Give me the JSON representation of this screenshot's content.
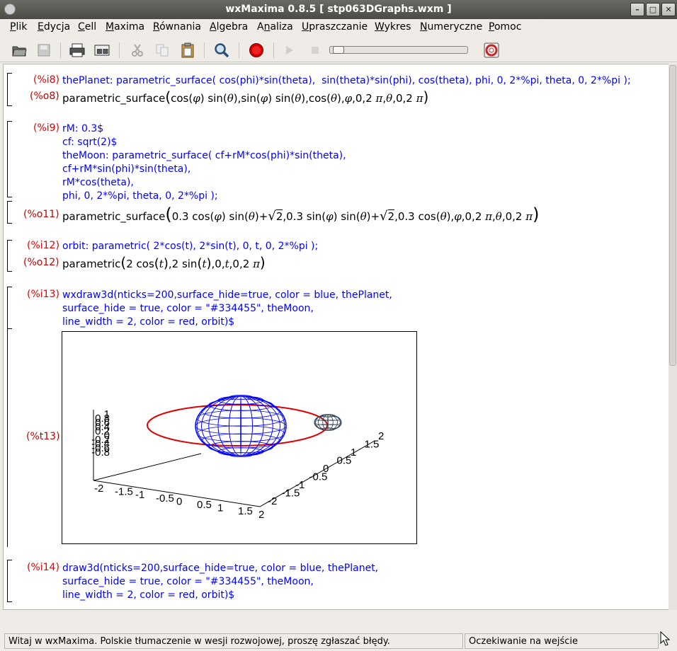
{
  "window": {
    "title": "wxMaxima 0.8.5  [ stp063DGraphs.wxm ]"
  },
  "menu": [
    "Plik",
    "Edycja",
    "Cell",
    "Maxima",
    "Równania",
    "Algebra",
    "Analiza",
    "Upraszczanie",
    "Wykres",
    "Numeryczne",
    "Pomoc"
  ],
  "menu_underline": [
    "P",
    "E",
    "C",
    "M",
    "R",
    "A",
    "n",
    "U",
    "W",
    "N",
    "P"
  ],
  "cells": {
    "i8": {
      "label": "(%i8)",
      "code": "thePlanet: parametric_surface( cos(phi)*sin(theta),  sin(theta)*sin(phi), cos(theta), phi, 0, 2*%pi, theta, 0, 2*%pi );"
    },
    "o8": {
      "label": "(%o8)"
    },
    "i9": {
      "label": "(%i9)",
      "code": "rM: 0.3$\ncf: sqrt(2)$\ntheMoon: parametric_surface( cf+rM*cos(phi)*sin(theta),\ncf+rM*sin(phi)*sin(theta),\nrM*cos(theta),\nphi, 0, 2*%pi, theta, 0, 2*%pi );"
    },
    "o11": {
      "label": "(%o11)"
    },
    "i12": {
      "label": "(%i12)",
      "code": "orbit: parametric( 2*cos(t), 2*sin(t), 0, t, 0, 2*%pi );"
    },
    "o12": {
      "label": "(%o12)"
    },
    "i13": {
      "label": "(%i13)",
      "code": "wxdraw3d(nticks=200,surface_hide=true, color = blue, thePlanet,\nsurface_hide = true, color = \"#334455\", theMoon,\nline_width = 2, color = red, orbit)$"
    },
    "t13": {
      "label": "(%t13)"
    },
    "i14": {
      "label": "(%i14)",
      "code": "draw3d(nticks=200,surface_hide=true, color = blue, thePlanet,\nsurface_hide = true, color = \"#334455\", theMoon,\nline_width = 2, color = red, orbit)$"
    }
  },
  "status": {
    "left": "Witaj w wxMaxima. Polskie tłumaczenie w wesji rozwojowej, proszę zgłaszać błędy.",
    "right": "Oczekiwanie na wejście"
  },
  "plot": {
    "z_ticks": [
      "1",
      "0.8",
      "0.6",
      "0.4",
      "0.2",
      "0",
      "-0.2",
      "-0.4",
      "-0.6",
      "-0.8"
    ],
    "x_ticks": [
      "-2",
      "-1.5",
      "-1",
      "-0.5",
      "0",
      "0.5",
      "1",
      "1.5",
      "2"
    ],
    "y_ticks": [
      "-2",
      "-1.5",
      "-1",
      "-0.5",
      "0",
      "0.5",
      "1",
      "1.5",
      "2"
    ],
    "colors": {
      "planet": "#0000ff",
      "moon": "#334455",
      "orbit": "#dd0000"
    }
  }
}
